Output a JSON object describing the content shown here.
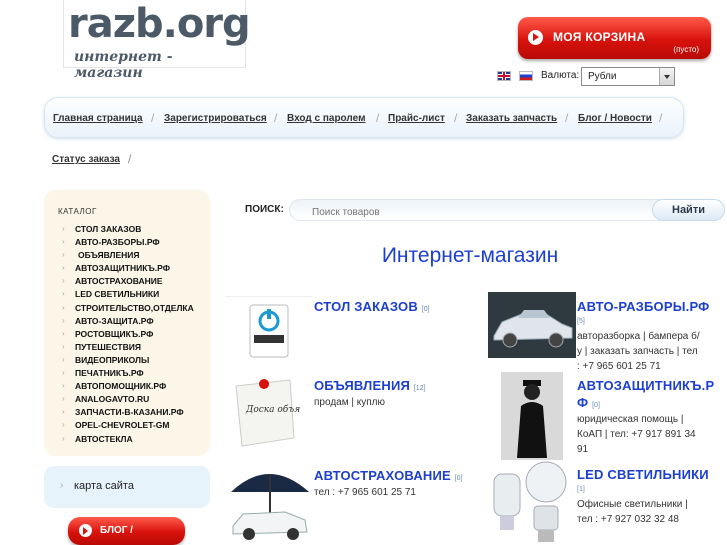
{
  "logo": {
    "title": "razb.org",
    "subtitle": "интернет - магазин"
  },
  "cart": {
    "label": "МОЯ КОРЗИНА",
    "status": "(пусто)"
  },
  "currency": {
    "label": "Валюта:",
    "selected": "Рубли"
  },
  "nav": {
    "items": [
      "Главная страница",
      "Зарегистрироваться",
      "Вход с паролем",
      "Прайс-лист",
      "Заказать запчасть",
      "Блог / Новости"
    ],
    "second_row": "Статус заказа"
  },
  "catalog": {
    "title": "КАТАЛОГ",
    "items": [
      "СТОЛ ЗАКАЗОВ",
      "АВТО-РАЗБОРЫ.РФ",
      "ОБЪЯВЛЕНИЯ",
      "АВТОЗАЩИТНИКЪ.РФ",
      "АВТОСТРАХОВАНИЕ",
      "LED СВЕТИЛЬНИКИ",
      "СТРОИТЕЛЬСТВО,ОТДЕЛКА",
      "АВТО-ЗАЩИТА.РФ",
      "РОСТОВЩИКЪ.РФ",
      "ПУТЕШЕСТВИЯ",
      "ВИДЕОПРИКОЛЫ",
      "ПЕЧАТНИКЪ.РФ",
      "АВТОПОМОЩНИК.РФ",
      "ANALOGAVTO.RU",
      "ЗАПЧАСТИ-В-КАЗАНИ.РФ",
      "OPEL-CHEVROLET-GM",
      "АВТОСТЕКЛА"
    ]
  },
  "sitemap": {
    "label": "карта сайта"
  },
  "blog": {
    "label": "БЛОГ /"
  },
  "search": {
    "label": "ПОИСК:",
    "placeholder": "Поиск товаров",
    "button": "Найти"
  },
  "main": {
    "title": "Интернет-магазин"
  },
  "products": [
    {
      "name": "СТОЛ ЗАКАЗОВ",
      "count": "[0]",
      "desc": [],
      "image_text": "СТОП ЗАКАЗОВ"
    },
    {
      "name": "АВТО-РАЗБОРЫ.РФ",
      "count": "[5]",
      "desc": [
        "авторазборка | бампера б/",
        "у | заказать запчасть | тел",
        ": +7 965 601 25 71"
      ]
    },
    {
      "name": "ОБЪЯВЛЕНИЯ",
      "count": "[12]",
      "desc": [
        "продам | куплю"
      ],
      "image_text": "Доска объявлений"
    },
    {
      "name": "АВТОЗАЩИТНИКЪ.Р",
      "name2": "Ф",
      "count": "[0]",
      "desc": [
        "юридическая помощь |",
        "КоАП | тел: +7 917 891 34",
        "91"
      ]
    },
    {
      "name": "АВТОСТРАХОВАНИЕ",
      "count": "[0]",
      "desc": [
        "тел : +7 965 601 25 71"
      ]
    },
    {
      "name": "LED СВЕТИЛЬНИКИ",
      "count": "[1]",
      "desc": [
        "Офисные светильники |",
        "тел : +7 927 032 32 48"
      ]
    }
  ],
  "colors": {
    "accent_red": "#d8120c",
    "link_blue": "#1c3fd0",
    "catalog_bg": "#fbf6e8",
    "sitemap_bg": "#e7f3fa"
  }
}
